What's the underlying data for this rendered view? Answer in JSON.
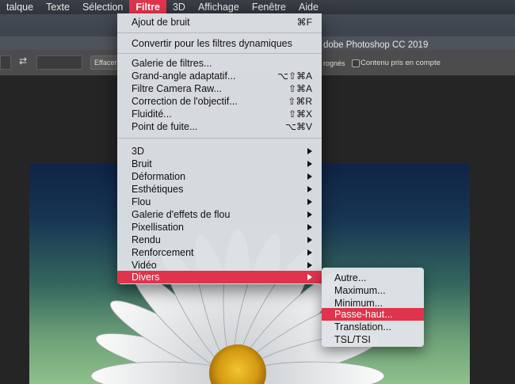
{
  "menubar": {
    "items": [
      "talque",
      "Texte",
      "Sélection",
      "Filtre",
      "3D",
      "Affichage",
      "Fenêtre",
      "Aide"
    ],
    "active": "Filtre"
  },
  "app": {
    "title": "dobe Photoshop CC 2019"
  },
  "options": {
    "swap_icon": "swap-arrows-icon",
    "clear_label": "Effacer",
    "crop_text": "rognés",
    "content_label": "Contenu pris en compte"
  },
  "filter_menu": {
    "last_filter": {
      "label": "Ajout de bruit",
      "shortcut": "⌘F"
    },
    "convert": {
      "label": "Convertir pour les filtres dynamiques"
    },
    "filters": [
      {
        "label": "Galerie de filtres...",
        "shortcut": ""
      },
      {
        "label": "Grand-angle adaptatif...",
        "shortcut": "⌥⇧⌘A"
      },
      {
        "label": "Filtre Camera Raw...",
        "shortcut": "⇧⌘A"
      },
      {
        "label": "Correction de l'objectif...",
        "shortcut": "⇧⌘R"
      },
      {
        "label": "Fluidité...",
        "shortcut": "⇧⌘X"
      },
      {
        "label": "Point de fuite...",
        "shortcut": "⌥⌘V"
      }
    ],
    "groups": [
      {
        "label": "3D"
      },
      {
        "label": "Bruit"
      },
      {
        "label": "Déformation"
      },
      {
        "label": "Esthétiques"
      },
      {
        "label": "Flou"
      },
      {
        "label": "Galerie d'effets de flou"
      },
      {
        "label": "Pixellisation"
      },
      {
        "label": "Rendu"
      },
      {
        "label": "Renforcement"
      },
      {
        "label": "Vidéo"
      },
      {
        "label": "Divers"
      }
    ],
    "selected_group": "Divers"
  },
  "submenu": {
    "items": [
      "Autre...",
      "Maximum...",
      "Minimum...",
      "Passe-haut...",
      "Translation...",
      "TSL/TSI"
    ],
    "selected": "Passe-haut..."
  },
  "colors": {
    "accent": "#e0344c",
    "menu_bg": "#dce0e4",
    "menubar_bg": "#353941"
  }
}
